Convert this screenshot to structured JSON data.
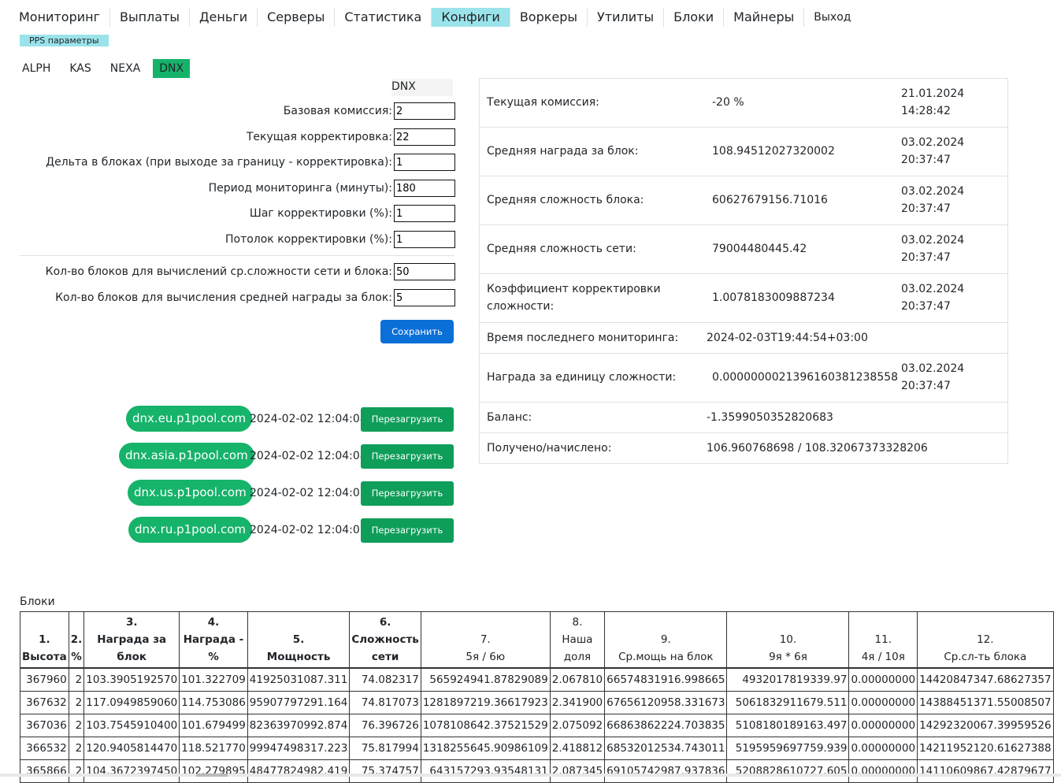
{
  "nav": {
    "items": [
      {
        "label": "Мониторинг",
        "active": false
      },
      {
        "label": "Выплаты",
        "active": false
      },
      {
        "label": "Деньги",
        "active": false
      },
      {
        "label": "Серверы",
        "active": false
      },
      {
        "label": "Статистика",
        "active": false
      },
      {
        "label": "Конфиги",
        "active": true
      },
      {
        "label": "Воркеры",
        "active": false
      },
      {
        "label": "Утилиты",
        "active": false
      },
      {
        "label": "Блоки",
        "active": false
      },
      {
        "label": "Майнеры",
        "active": false
      },
      {
        "label": "Выход",
        "active": false
      }
    ],
    "active_color": "#9be3ea"
  },
  "subtab": {
    "label": "PPS параметры"
  },
  "coins": [
    {
      "label": "ALPH",
      "active": false
    },
    {
      "label": "KAS",
      "active": false
    },
    {
      "label": "NEXA",
      "active": false
    },
    {
      "label": "DNX",
      "active": true
    }
  ],
  "form": {
    "coin": "DNX",
    "fields": [
      {
        "label": "Базовая комиссия:",
        "value": "2"
      },
      {
        "label": "Текущая корректировка:",
        "value": "22"
      },
      {
        "label": "Дельта в блоках (при выходе за границу - корректировка):",
        "value": "1"
      },
      {
        "label": "Период мониторинга (минуты):",
        "value": "180"
      },
      {
        "label": "Шаг корректировки (%):",
        "value": "1"
      },
      {
        "label": "Потолок корректировки (%):",
        "value": "1"
      },
      {
        "label": "Кол-во блоков для вычислений ср.сложности сети и блока:",
        "value": "50"
      },
      {
        "label": "Кол-во блоков для вычисления средней награды за блок:",
        "value": "5"
      }
    ],
    "save_label": "Сохранить"
  },
  "stats": [
    {
      "label": "Текущая комиссия:",
      "value": "-20 %",
      "date": "21.01.2024",
      "time": "14:28:42"
    },
    {
      "label": "Средняя награда за блок:",
      "value": "108.94512027320002",
      "date": "03.02.2024",
      "time": "20:37:47"
    },
    {
      "label": "Средняя сложность блока:",
      "value": "60627679156.71016",
      "date": "03.02.2024",
      "time": "20:37:47"
    },
    {
      "label": "Средняя сложность сети:",
      "value": "79004480445.42",
      "date": "03.02.2024",
      "time": "20:37:47"
    },
    {
      "label": "Коэффициент корректировки сложности:",
      "value": "1.0078183009887234",
      "date": "03.02.2024",
      "time": "20:37:47"
    },
    {
      "label": "Время последнего мониторинга:",
      "value": "2024-02-03T19:44:54+03:00",
      "date": "",
      "time": ""
    },
    {
      "label": "Награда за единицу сложности:",
      "value": "0.000000002139616038123855​8",
      "date": "03.02.2024",
      "time": "20:37:47"
    },
    {
      "label": "Баланс:",
      "value": "-1.3599050352820683",
      "date": "",
      "time": ""
    },
    {
      "label": "Получено/начислено:",
      "value": "106.960768698 / 108.32067373328206",
      "date": "",
      "time": ""
    }
  ],
  "servers": [
    {
      "host": "dnx.eu.p1pool.com",
      "time": "2024-02-02 12:04:08",
      "button": "Перезагрузить"
    },
    {
      "host": "dnx.asia.p1pool.com",
      "time": "2024-02-02 12:04:08",
      "button": "Перезагрузить"
    },
    {
      "host": "dnx.us.p1pool.com",
      "time": "2024-02-02 12:04:07",
      "button": "Перезагрузить"
    },
    {
      "host": "dnx.ru.p1pool.com",
      "time": "2024-02-02 12:04:07",
      "button": "Перезагрузить"
    }
  ],
  "blocks": {
    "title": "Блоки",
    "headers": [
      [
        "1.",
        "Высота"
      ],
      [
        "2.",
        "%"
      ],
      [
        "3.",
        "Награда за",
        "блок"
      ],
      [
        "4.",
        "Награда -",
        "%"
      ],
      [
        "5.",
        "Мощность"
      ],
      [
        "6.",
        "Сложность",
        "сети"
      ],
      [
        "7.",
        "5я / 6ю"
      ],
      [
        "8.",
        "Наша",
        "доля"
      ],
      [
        "9.",
        "Ср.мощь на блок"
      ],
      [
        "10.",
        "9я * 6я"
      ],
      [
        "11.",
        "4я / 10я"
      ],
      [
        "12.",
        "Ср.сл-ть блока"
      ]
    ],
    "rows": [
      [
        "367960",
        "2",
        "103.3905192570",
        "101.322709",
        "41925031087.311",
        "74.082317",
        "565924941.87829089",
        "2.067810",
        "66574831916.998665",
        "4932017819339.97",
        "0.00000000",
        "14420847347.68627357"
      ],
      [
        "367632",
        "2",
        "117.0949859060",
        "114.753086",
        "95907797291.164",
        "74.817073",
        "1281897219.36617923",
        "2.341900",
        "67656120958.331673",
        "5061832911679.511",
        "0.00000000",
        "14388451371.55008507"
      ],
      [
        "367036",
        "2",
        "103.7545910400",
        "101.679499",
        "82363970992.874",
        "76.396726",
        "1078108642.37521529",
        "2.075092",
        "66863862224.703835",
        "5108180189163.497",
        "0.00000000",
        "14292320067.39959526"
      ],
      [
        "366532",
        "2",
        "120.9405814470",
        "118.521770",
        "99947498317.223",
        "75.817994",
        "1318255645.90986109",
        "2.418812",
        "68532012534.743011",
        "5195959697759.939",
        "0.00000000",
        "14211952120.61627388"
      ],
      [
        "365866",
        "2",
        "104.3672397450",
        "102.279895",
        "48477824982.419",
        "75.374757",
        "643157293.93548131",
        "2.087345",
        "69105742987.937836",
        "5208828610727.605",
        "0.00000000",
        "14110609867.42879677"
      ]
    ]
  }
}
